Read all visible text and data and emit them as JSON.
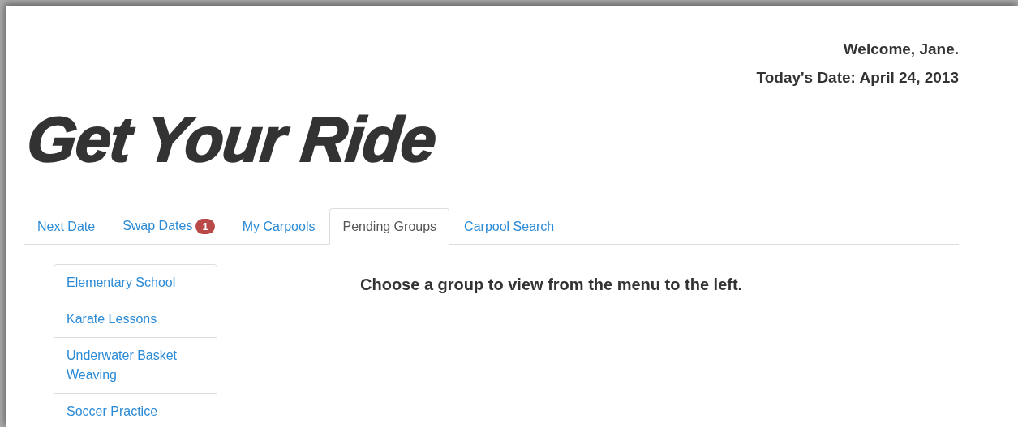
{
  "header": {
    "welcome": "Welcome, Jane.",
    "date": "Today's Date: April 24, 2013"
  },
  "logo": "Get Your Ride",
  "tabs": [
    {
      "label": "Next Date",
      "selected": false
    },
    {
      "label": "Swap Dates",
      "selected": false,
      "badge": "1"
    },
    {
      "label": "My Carpools",
      "selected": false
    },
    {
      "label": "Pending Groups",
      "selected": true
    },
    {
      "label": "Carpool Search",
      "selected": false
    }
  ],
  "sidebar": {
    "items": [
      "Elementary School",
      "Karate Lessons",
      "Underwater Basket Weaving",
      "Soccer Practice"
    ]
  },
  "main": {
    "message": "Choose a group to view from the menu to the left."
  }
}
